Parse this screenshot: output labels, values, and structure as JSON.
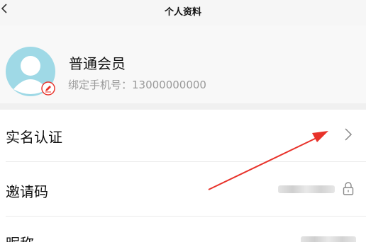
{
  "header": {
    "title": "个人资料",
    "back_icon": "chevron-left-icon"
  },
  "profile": {
    "member_level": "普通会员",
    "phone_text": "绑定手机号：13000000000",
    "avatar_icon": "user-avatar-icon",
    "edit_icon": "edit-icon"
  },
  "rows": [
    {
      "label": "实名认证",
      "trailing_icon": "chevron-right-icon"
    },
    {
      "label": "邀请码",
      "trailing_icon": "lock-icon"
    },
    {
      "label": "昵称"
    }
  ],
  "colors": {
    "accent": "#e8322a",
    "avatar": "#9fd9e6",
    "background": "#f8f8f8"
  }
}
